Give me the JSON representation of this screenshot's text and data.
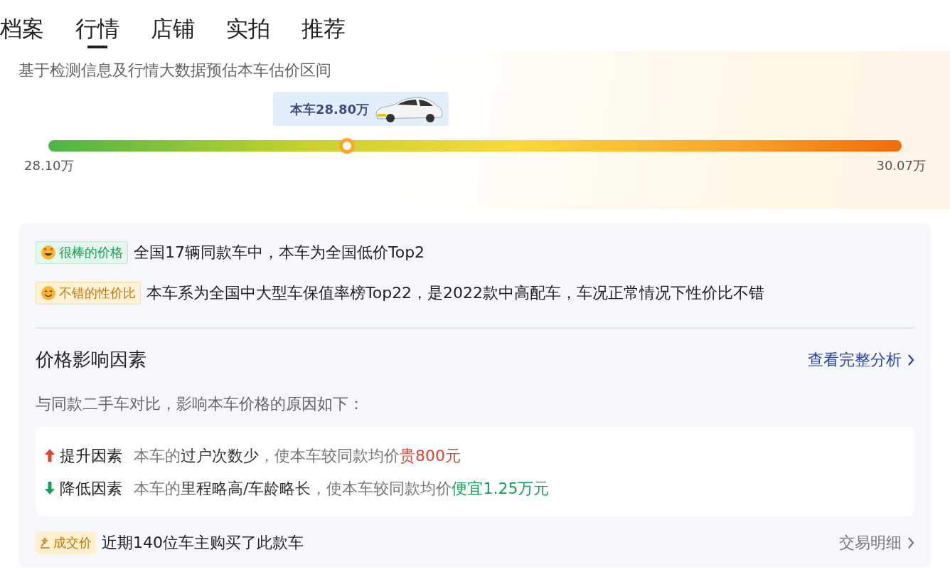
{
  "tabs": [
    {
      "label": "档案",
      "selected": false
    },
    {
      "label": "行情",
      "selected": true
    },
    {
      "label": "店铺",
      "selected": false
    },
    {
      "label": "实拍",
      "selected": false
    },
    {
      "label": "推荐",
      "selected": false
    }
  ],
  "estimate": {
    "subtitle": "基于检测信息及行情大数据预估本车估价区间",
    "bubble": "本车28.80万",
    "level": 0.35,
    "min_label": "28.10万",
    "max_label": "30.07万"
  },
  "ratings": [
    {
      "kind": "great",
      "badge": "很棒的价格",
      "text": "全国17辆同款车中，本车为全国低价Top2"
    },
    {
      "kind": "good",
      "badge": "不错的性价比",
      "text": "本车系为全国中大型车保值率榜Top22，是2022款中高配车，车况正常情况下性价比不错"
    }
  ],
  "factors_section": {
    "title": "价格影响因素",
    "link": "查看完整分析",
    "intro": "与同款二手车对比，影响本车价格的原因如下：",
    "factors": [
      {
        "kind": "up",
        "label": "提升因素",
        "parts": [
          {
            "color": "#777777",
            "text": "本车的"
          },
          {
            "color": "#333333",
            "text": "过户次数少"
          },
          {
            "color": "#777777",
            "text": "，使本车较同款均价"
          },
          {
            "color": "#e0412a",
            "text": "贵800元"
          }
        ]
      },
      {
        "kind": "down",
        "label": "降低因素",
        "parts": [
          {
            "color": "#777777",
            "text": "本车的"
          },
          {
            "color": "#333333",
            "text": "里程略高/车龄略长"
          },
          {
            "color": "#777777",
            "text": "，使本车较同款均价"
          },
          {
            "color": "#12a15a",
            "text": "便宜1.25万元"
          }
        ]
      }
    ]
  },
  "deal": {
    "badge": "成交价",
    "text": "近期140位车主购买了此款车",
    "link": "交易明细"
  }
}
